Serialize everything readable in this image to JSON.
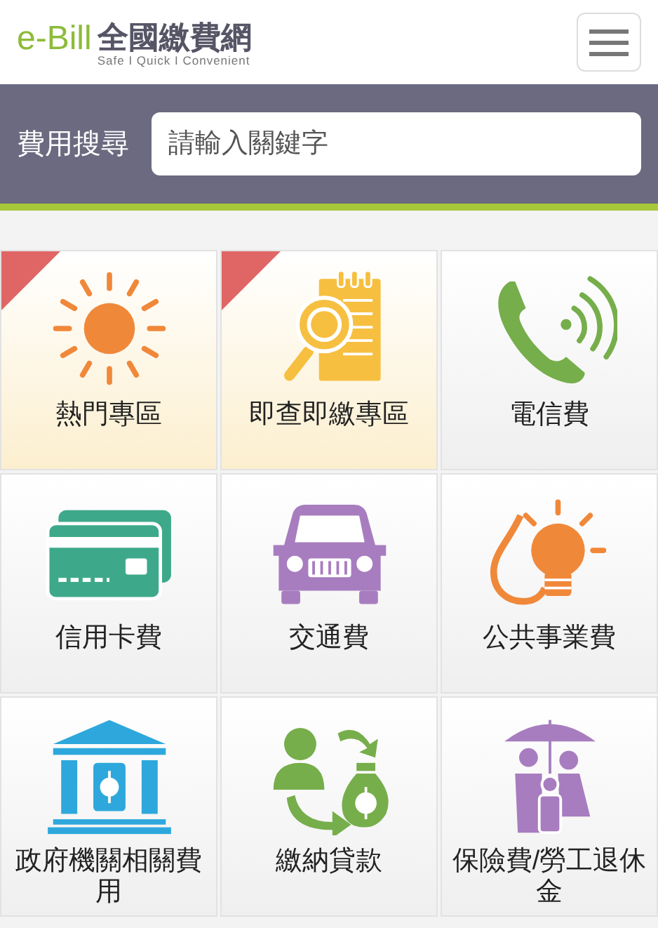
{
  "header": {
    "logo_mark": "e-Bill",
    "logo_title": "全國繳費網",
    "tagline": "Safe I Quick I Convenient"
  },
  "search": {
    "label": "費用搜尋",
    "placeholder": "請輸入關鍵字"
  },
  "tiles": [
    {
      "label": "熱門專區",
      "featured": true
    },
    {
      "label": "即查即繳專區",
      "featured": true
    },
    {
      "label": "電信費",
      "featured": false
    },
    {
      "label": "信用卡費",
      "featured": false
    },
    {
      "label": "交通費",
      "featured": false
    },
    {
      "label": "公共事業費",
      "featured": false
    },
    {
      "label": "政府機關相關費用",
      "featured": false
    },
    {
      "label": "繳納貸款",
      "featured": false
    },
    {
      "label": "保險費/勞工退休金",
      "featured": false
    }
  ]
}
